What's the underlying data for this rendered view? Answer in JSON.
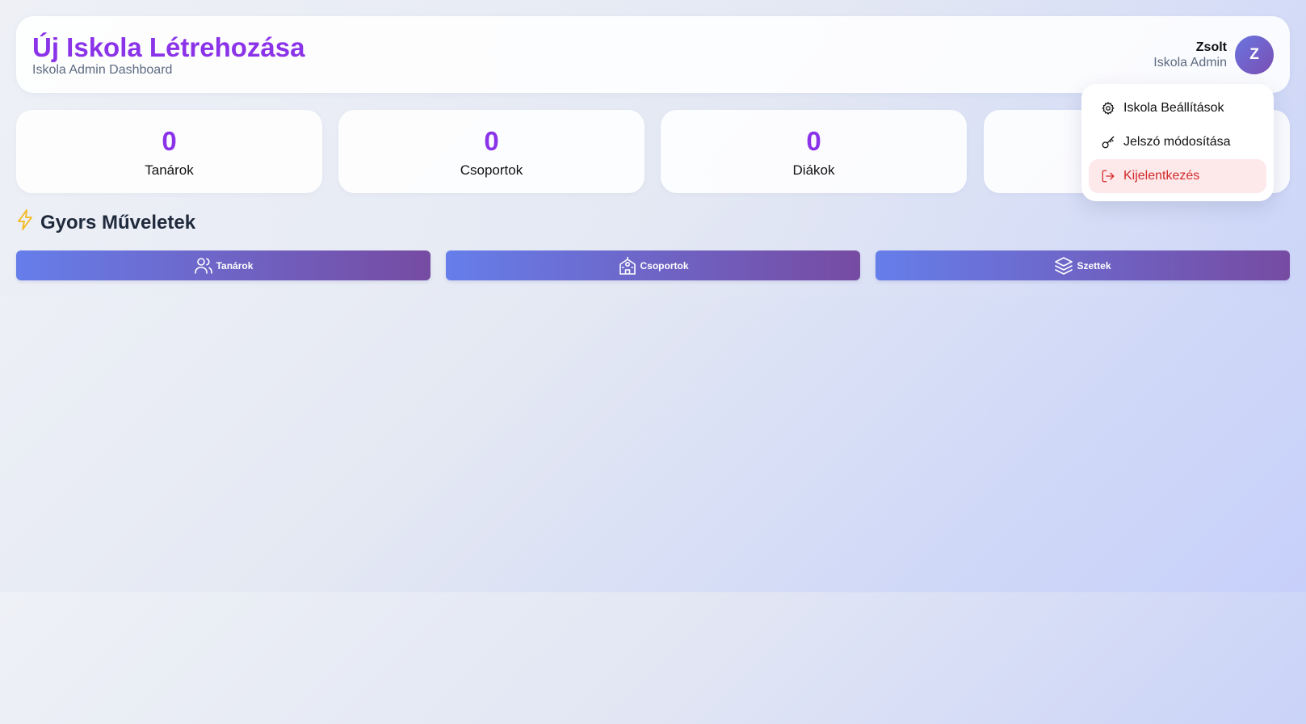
{
  "header": {
    "title": "Új Iskola Létrehozása",
    "subtitle": "Iskola Admin Dashboard"
  },
  "user": {
    "name": "Zsolt",
    "role": "Iskola Admin",
    "avatar_initial": "Z"
  },
  "stats": [
    {
      "value": "0",
      "label": "Tanárok"
    },
    {
      "value": "0",
      "label": "Csoportok"
    },
    {
      "value": "0",
      "label": "Diákok"
    },
    {
      "value": "",
      "label": ""
    }
  ],
  "quick_actions": {
    "title": "Gyors Műveletek",
    "icon": "lightning-icon",
    "buttons": [
      {
        "label": "Tanárok",
        "icon": "users-icon"
      },
      {
        "label": "Csoportok",
        "icon": "school-icon"
      },
      {
        "label": "Szettek",
        "icon": "layers-icon"
      }
    ]
  },
  "user_menu": {
    "items": [
      {
        "label": "Iskola Beállítások",
        "icon": "gear-icon"
      },
      {
        "label": "Jelszó módosítása",
        "icon": "key-icon"
      },
      {
        "label": "Kijelentkezés",
        "icon": "logout-icon"
      }
    ]
  },
  "colors": {
    "accent": "#8a33e8",
    "button_gradient_start": "#667eea",
    "button_gradient_end": "#764ba2",
    "danger": "#d22b2b",
    "danger_bg": "#fde8ea",
    "lightning": "#f5b91c"
  }
}
